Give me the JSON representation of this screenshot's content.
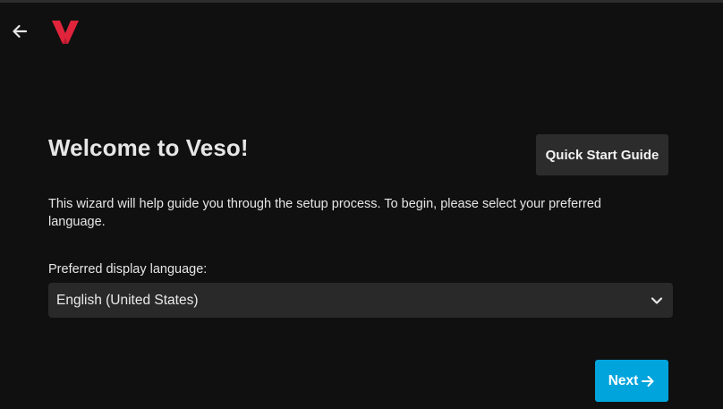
{
  "header": {
    "back_icon": "arrow-left-icon",
    "logo": "veso-logo",
    "logo_color": "#e0243b"
  },
  "wizard": {
    "title": "Welcome to Veso!",
    "quick_start_label": "Quick Start Guide",
    "intro": "This wizard will help guide you through the setup process. To begin, please select your preferred language.",
    "language_label": "Preferred display language:",
    "language_value": "English (United States)",
    "dropdown_icon": "chevron-down-icon",
    "next_label": "Next",
    "next_icon": "arrow-right-icon",
    "accent_color": "#00a4dc"
  }
}
